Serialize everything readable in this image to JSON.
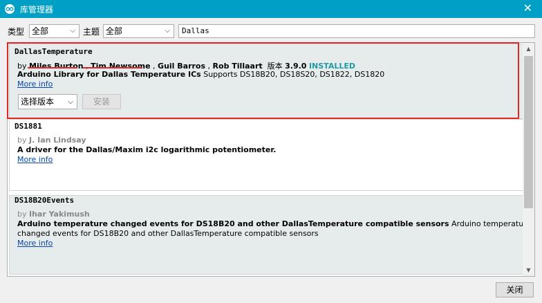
{
  "window": {
    "title": "库管理器",
    "close_symbol": "✕"
  },
  "filters": {
    "type_label": "类型",
    "type_value": "全部",
    "topic_label": "主题",
    "topic_value": "全部",
    "search_value": "Dallas"
  },
  "libraries": [
    {
      "name": "DallasTemperature",
      "by": "by",
      "authors": [
        "Miles Burton",
        "Tim Newsome",
        "Guil Barros",
        "Rob Tillaart"
      ],
      "version_label": "版本",
      "version": "3.9.0",
      "status": "INSTALLED",
      "summary": "Arduino Library for Dallas Temperature ICs",
      "description": "Supports DS18B20, DS18S20, DS1822, DS1820",
      "more_info": "More info",
      "version_select": "选择版本",
      "install_label": "安装"
    },
    {
      "name": "DS1881",
      "by": "by",
      "authors": [
        "J. Ian Lindsay"
      ],
      "summary": "A driver for the Dallas/Maxim i2c logarithmic potentiometer.",
      "more_info": "More info"
    },
    {
      "name": "DS18B20Events",
      "by": "by",
      "authors": [
        "Ihar Yakimush"
      ],
      "summary": "Arduino temperature changed events for DS18B20 and other DallasTemperature compatible sensors",
      "description_1": "Arduino temperature",
      "description_2": "changed events for DS18B20 and other DallasTemperature compatible sensors",
      "more_info": "More info"
    }
  ],
  "footer": {
    "close_label": "关闭"
  },
  "colors": {
    "titlebar": "#00a0c6",
    "installed": "#1e9ba4",
    "highlight": "#e02828",
    "link": "#0645ad"
  }
}
